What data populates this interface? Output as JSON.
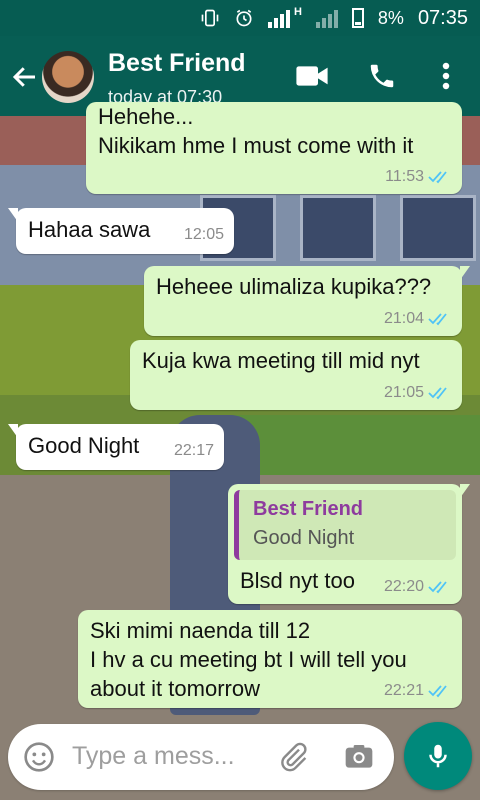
{
  "status_bar": {
    "battery": "8%",
    "time": "07:35",
    "network": "H"
  },
  "header": {
    "contact_name": "Best Friend",
    "last_seen": "today at 07:30"
  },
  "messages": [
    {
      "dir": "out",
      "text": "Hehehe...\nNikikam hme I must come with it",
      "time": "11:53"
    },
    {
      "dir": "in",
      "text": "Hahaa sawa",
      "time": "12:05"
    },
    {
      "dir": "out",
      "text": "Heheee ulimaliza kupika???",
      "time": "21:04"
    },
    {
      "dir": "out",
      "text": "Kuja kwa meeting till mid nyt",
      "time": "21:05"
    },
    {
      "dir": "in",
      "text": "Good Night",
      "time": "22:17"
    },
    {
      "dir": "out",
      "quote_name": "Best Friend",
      "quote_text": "Good Night",
      "text": "Blsd nyt too",
      "time": "22:20"
    },
    {
      "dir": "out",
      "text": "Ski mimi naenda till 12\nI hv a cu meeting bt I will tell you\nabout it tomorrow",
      "time": "22:21"
    }
  ],
  "composer": {
    "placeholder": "Type a mess..."
  },
  "colors": {
    "header": "#075e54",
    "status_bar": "#065c52",
    "outgoing_bubble": "#dcf8c6",
    "incoming_bubble": "#ffffff",
    "read_ticks": "#4fc3f7",
    "mic_button": "#00897b"
  },
  "icons": [
    "back-arrow-icon",
    "video-call-icon",
    "phone-icon",
    "more-vert-icon",
    "emoji-icon",
    "attach-icon",
    "camera-icon",
    "mic-icon"
  ]
}
